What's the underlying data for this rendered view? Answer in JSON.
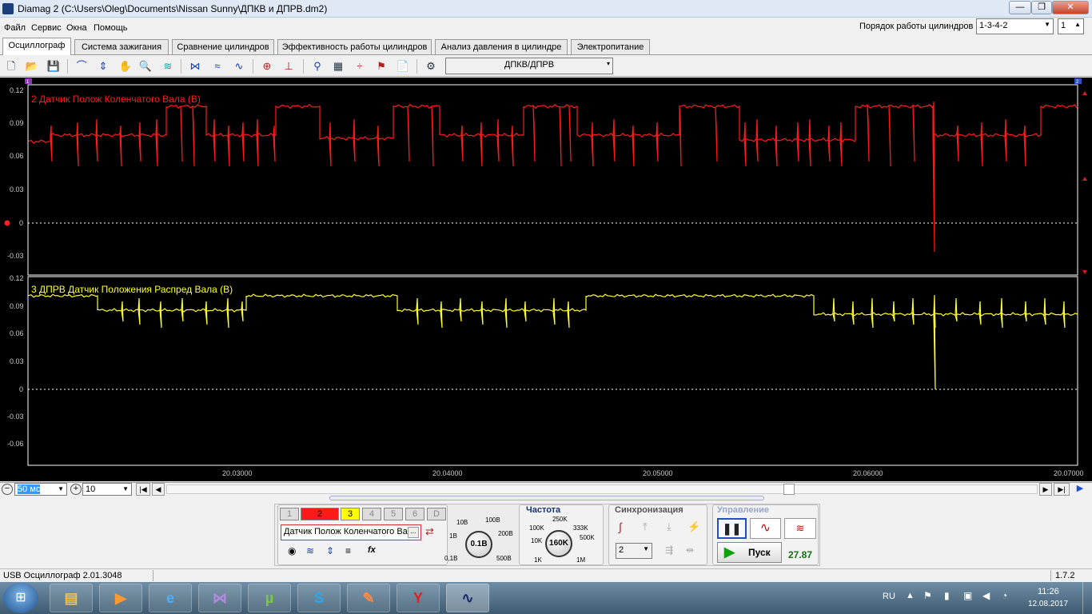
{
  "window": {
    "title": "Diamag 2 (C:\\Users\\Oleg\\Documents\\Nissan Sunny\\ДПКВ и ДПРВ.dm2)",
    "min": "—",
    "max": "❐",
    "close": "✕"
  },
  "menu": [
    "Файл",
    "Сервис",
    "Окна",
    "Помощь"
  ],
  "cylinder_order": {
    "label": "Порядок работы цилиндров",
    "value": "1-3-4-2",
    "count": "1"
  },
  "tabs": [
    "Осциллограф",
    "Система зажигания",
    "Сравнение цилиндров",
    "Эффективность работы цилиндров",
    "Анализ давления в цилиндре",
    "Электропитание"
  ],
  "toolbar": {
    "preset": "ДПКВ/ДПРВ"
  },
  "scope": {
    "channel_a": {
      "label": "2 Датчик Полож Коленчатого Вала (В)",
      "color": "#ff1a1a",
      "yticks": [
        "0.12",
        "0.09",
        "0.06",
        "0.03",
        "0",
        "-0.03"
      ],
      "marker": "1"
    },
    "channel_b": {
      "label": "3 ДПРВ Датчик Положения Распред Вала (В)",
      "color": "#ffff33",
      "yticks": [
        "0.12",
        "0.09",
        "0.06",
        "0.03",
        "0",
        "-0.03",
        "-0.06"
      ],
      "marker": "2"
    },
    "xticks": [
      "20.03000",
      "20.04000",
      "20.05000",
      "20.06000",
      "20.07000"
    ]
  },
  "hscroll": {
    "timebase": "50 мс",
    "scale": "10"
  },
  "control": {
    "channels": [
      "1",
      "2",
      "3",
      "4",
      "5",
      "6",
      "D"
    ],
    "channel_name": "Датчик Полож Коленчатого Ва",
    "volt_knob": {
      "value": "0.1В",
      "labels": [
        "10В",
        "100В",
        "1В",
        "200В",
        "0,1В",
        "500В"
      ]
    },
    "freq": {
      "title": "Частота",
      "value": "160K",
      "labels": [
        "250K",
        "100K",
        "333K",
        "10K",
        "500K",
        "1K",
        "1M"
      ]
    },
    "sync": {
      "title": "Синхронизация",
      "value": "2"
    },
    "manage": {
      "title": "Управление",
      "start": "Пуск",
      "value": "27.87"
    }
  },
  "status": {
    "left": "USB Осциллограф  2.01.3048",
    "right": "1.7.2"
  },
  "taskbar": {
    "apps": [
      "explorer-icon",
      "media-player-icon",
      "ie-icon",
      "visual-studio-icon",
      "utorrent-icon",
      "skype-icon",
      "editor-icon",
      "yandex-icon",
      "diamag-icon"
    ],
    "lang": "RU",
    "time": "11:26",
    "date": "12.08.2017"
  }
}
